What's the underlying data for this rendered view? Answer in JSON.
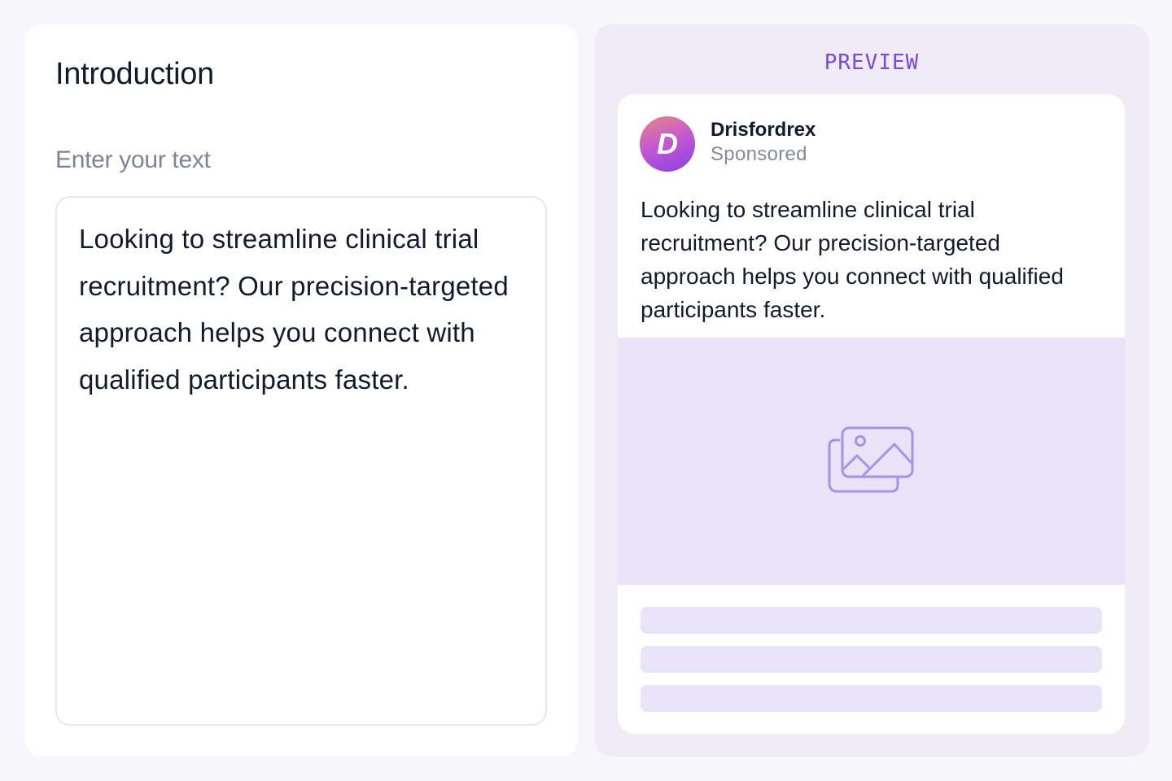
{
  "editor": {
    "title": "Introduction",
    "field_label": "Enter your text",
    "text_value": "Looking to streamline clinical trial recruitment? Our precision-​targeted approach helps you connect with qualified participants faster."
  },
  "preview": {
    "label": "PREVIEW",
    "ad": {
      "avatar_letter": "D",
      "brand_name": "Drisfordrex",
      "sponsored_label": "Sponsored",
      "body_text": "Looking to streamline clinical trial recruitment? Our precision-targeted approach helps you connect with qualified participants faster.",
      "image_placeholder_icon": "image-gallery-icon"
    }
  },
  "colors": {
    "accent": "#7a48e0",
    "text_primary": "#141a2e",
    "text_muted": "#7d8496",
    "placeholder_fill": "#e8e3f6",
    "preview_bg": "#efecf8"
  }
}
